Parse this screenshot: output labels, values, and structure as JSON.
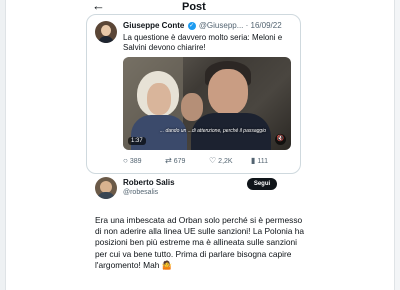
{
  "header": {
    "back_icon": "arrow-left-icon",
    "title": "Post"
  },
  "quoted_post": {
    "author_name": "Giuseppe Conte",
    "verified_icon": "verified-badge-icon",
    "handle_and_date": "@Giusepp... · 16/09/22",
    "text": "La questione è davvero molto seria: Meloni e Salvini devono chiarire!",
    "video": {
      "caption": "... dando un ...di attenzione, perché il passaggio",
      "duration": "1:37",
      "mute_icon": "speaker-muted-icon"
    },
    "actions": {
      "replies": "389",
      "reposts": "679",
      "likes": "2,2K",
      "views": "111"
    }
  },
  "reply": {
    "author_name": "Roberto Salis",
    "handle": "@robesalis",
    "follow_label": "Segui",
    "text": "Era una imbescata ad Orban solo perché si è permesso di non aderire alla linea UE sulle sanzioni! La Polonia ha posizioni ben più estreme ma è allineata sulle sanzioni per cui va bene tutto. Prima di parlare bisogna capire l'argomento! Mah 🤷"
  },
  "colors": {
    "text": "#0f1419",
    "secondary_text": "#536471",
    "border": "#cfd9de",
    "verified": "#1d9bf0",
    "button_bg": "#0f1419"
  }
}
